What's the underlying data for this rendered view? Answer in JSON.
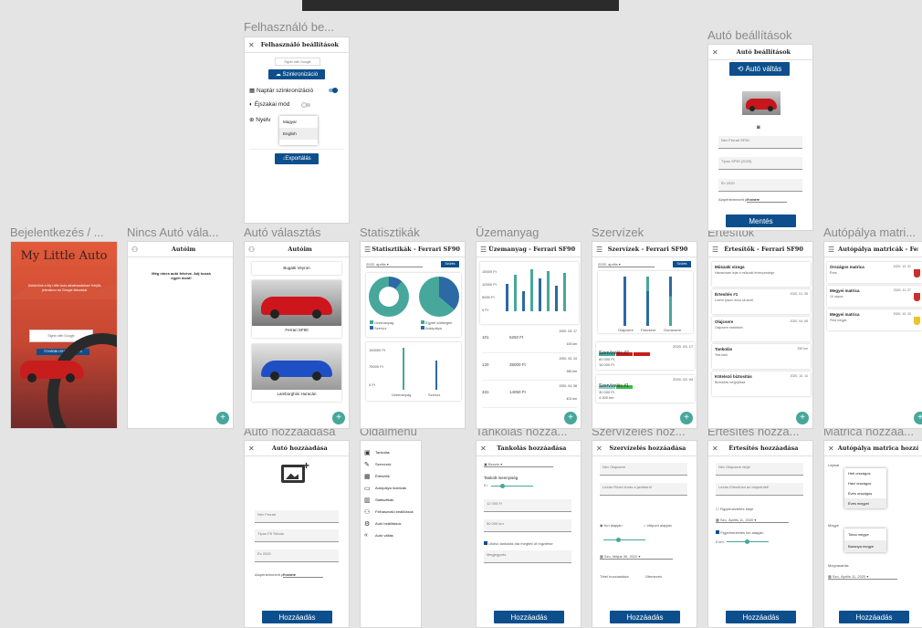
{
  "labels": {
    "user_settings": "Felhasználó be...",
    "car_settings": "Autó beállítások",
    "login": "Bejelentkezés / ...",
    "no_car": "Nincs Autó vála...",
    "car_select": "Autó választás",
    "stats": "Statisztikák",
    "fuel": "Üzemanyag",
    "services": "Szervízek",
    "notifications": "Értesítők",
    "vignette": "Autópálya matri...",
    "car_add": "Autó hozzáadása",
    "side_menu": "Oldalmenü",
    "refuel_add": "Tankolás hozzá...",
    "service_add": "Szervízelés hoz...",
    "notif_add": "Értesítés hozzá...",
    "vignette_add": "Matrica hozzáa..."
  },
  "user_settings": {
    "title": "Felhasználó beállítások",
    "google": "Signin with Google",
    "sync_button": "Szinkronizáció",
    "calendar_sync": "Naptár szinkronizáció",
    "night_mode": "Éjszakai mód",
    "language": "Nyelv",
    "lang_options": [
      "Magyar",
      "English"
    ],
    "export_button": "Exportálás"
  },
  "car_settings": {
    "title": "Autó beállítások",
    "switch_button": "Autó váltás",
    "fields": [
      "Ferrari SF90",
      "SF90 (2020)",
      "2020"
    ],
    "field_labels": [
      "Név",
      "Típus",
      "Év"
    ],
    "currency": "Alapértelmezett pénznem",
    "currency_val": "Forint",
    "save_button": "Mentés"
  },
  "login": {
    "title": "My Little Auto",
    "text": "Üdvözlünk a My Little Auto alkalmazásban! Kérjük, jelentkezz be Google fiókoddal.",
    "google": "Signin with Google",
    "sync": "TOVÁBBI LEHETŐSÉGEK"
  },
  "no_car": {
    "title": "Autóim",
    "text": "Még nincs autó felvéve. Adj hozzá egyet most!"
  },
  "car_select": {
    "title": "Autóim",
    "cars": [
      "Bugatti Veyron",
      "Ferrari SF90",
      "Lamborghini Huracán"
    ]
  },
  "stats": {
    "title": "Statisztikák - Ferrari SF90",
    "period": "2020. április",
    "period_btn": "Szűrés",
    "legend": [
      "Üzemanyag",
      "Szervíz",
      "Egyéb költségek",
      "Autópálya"
    ],
    "bar_labels": [
      "Üzemanyag",
      "Szervíz"
    ],
    "yticks": [
      "150000 Ft",
      "75000 Ft",
      "0 Ft"
    ]
  },
  "fuel": {
    "title": "Üzemanyag - Ferrari SF90",
    "ytick": [
      "15000 Ft",
      "10000 Ft",
      "5000 Ft",
      "0 Ft"
    ],
    "entries": [
      {
        "l": "101",
        "amount": "6250 Ft",
        "date": "2020. 03. 17",
        "km": "100 km"
      },
      {
        "l": "120",
        "amount": "35000 Ft",
        "date": "2020. 03. 24",
        "km": "350 km"
      },
      {
        "l": "331",
        "amount": "14050 Ft",
        "date": "2020. 04. 08",
        "km": "401 km"
      }
    ]
  },
  "services": {
    "title": "Szervízek - Ferrari SF90",
    "filter": "2020. április",
    "btn": "Szűrés",
    "labels": [
      "Olajcsere",
      "Fékcsere",
      "Gumicsere"
    ],
    "items": [
      {
        "title": "Szervízelés #2",
        "price": "60 000 Ft",
        "note": "16 000 Ft",
        "date": "2020. 03. 17"
      },
      {
        "title": "Szervízelés #1",
        "price": "30 000 Ft",
        "note": "4 000 km",
        "date": "2020. 03. 04"
      }
    ]
  },
  "notifications": {
    "title": "Értesítők - Ferrari SF90",
    "items": [
      {
        "title": "Műszaki vizsga",
        "note": "Hamarosan lejár a műszaki érvényessége.",
        "date": ""
      },
      {
        "title": "Értesítés #1",
        "note": "Lorem ipsum dolor sit amet",
        "date": "2020. 01. 05"
      },
      {
        "title": "Olajcsere",
        "note": "Olajcsere esedékes",
        "date": "2020. 04. 08"
      },
      {
        "title": "Tankolás",
        "note": "Tele tank",
        "date": "250 km"
      },
      {
        "title": "Kötelező biztosítás",
        "note": "Biztosítás megújítása",
        "date": "2020. 10. 14"
      }
    ]
  },
  "vignette": {
    "title": "Autópálya matricák - Ferrari SF90",
    "items": [
      {
        "title": "Országos matrica",
        "note": "Éves",
        "date": "2020. 12. 31"
      },
      {
        "title": "Megyei matrica",
        "note": "10 napos",
        "date": "2020. 11. 27"
      },
      {
        "title": "Megyei matrica",
        "note": "Pest megye",
        "date": "2020. 10. 23"
      }
    ]
  },
  "car_add": {
    "title": "Autó hozzáadása",
    "fields": [
      "Ferrari",
      "F8 Tributo",
      "2020"
    ],
    "field_labels": [
      "Név",
      "Típus",
      "Év"
    ],
    "currency": "Alapértelmezett pénznem",
    "currency_val": "Forint",
    "add_button": "Hozzáadás"
  },
  "side_menu": {
    "items": [
      "Tankolás",
      "Szervízek",
      "Értesítők",
      "Autópálya matricák",
      "Statisztikák",
      "Felhasználó beállítások",
      "Autó beállítások",
      "Autó váltás"
    ]
  },
  "refuel_add": {
    "title": "Tankolás hozzáadása",
    "type": "Benzin",
    "amount_label": "Tankolt mennyiség",
    "amount_val": "0 l",
    "price": "12 000 Ft",
    "km": "50 000 km",
    "check": "Utolsó tankolás óta megtett út rögzítése",
    "note": "Megjegyzés",
    "add_button": "Hozzáadás"
  },
  "service_add": {
    "title": "Szervízelés hozzáadása",
    "fields": [
      "Olajcsere",
      "Rövid leírás a javításról"
    ],
    "field_labels": [
      "Név",
      "Leírás"
    ],
    "radio1": "Km alapján",
    "radio2": "Időpont alapján",
    "date": "Szo, Május 30, 2020",
    "tabs": [
      "Tétel hozzáadása",
      "Ütemezés"
    ],
    "add_button": "Hozzáadás"
  },
  "notif_add": {
    "title": "Értesítés hozzáadása",
    "fields": [
      "Olajcsere ideje",
      "Ellenőrizd az olajszintet!"
    ],
    "field_labels": [
      "Név",
      "Leírás"
    ],
    "check1": "Figyelmeztetés ideje",
    "date": "Szo, Április 11, 2020",
    "check2": "Figyelmeztetés km alapján",
    "km": "0 km",
    "add_button": "Hozzáadás"
  },
  "vignette_add": {
    "title": "Autópálya matrica hozzáadása",
    "type_label": "Lejárat",
    "types": [
      "Heti országos",
      "Havi országos",
      "Éves országos",
      "Éves megyei"
    ],
    "county_label": "Megye",
    "counties": [
      "Tolna megye",
      "Baranya megye"
    ],
    "expiry_label": "Megvásárlás",
    "date": "Szo, Április 11, 2020",
    "add_button": "Hozzáadás"
  },
  "colors": {
    "primary": "#0d4f8c",
    "teal": "#46a79a",
    "red": "#c0392b"
  }
}
